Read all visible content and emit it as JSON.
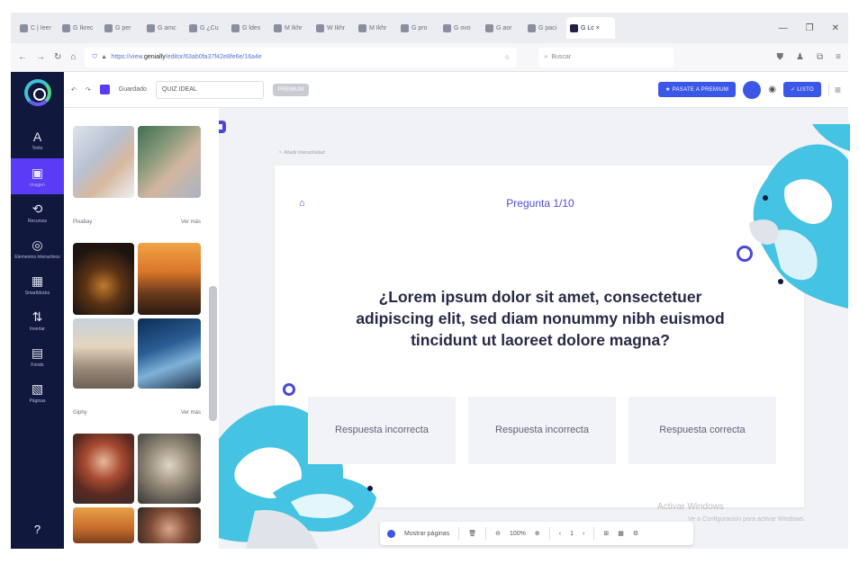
{
  "browser": {
    "tabs": [
      {
        "label": "C | Ieer"
      },
      {
        "label": "G Ikrec"
      },
      {
        "label": "G per"
      },
      {
        "label": "G amc"
      },
      {
        "label": "G ¿Cu"
      },
      {
        "label": "G ldes"
      },
      {
        "label": "M Ikhr"
      },
      {
        "label": "W Ikhr"
      },
      {
        "label": "M Ikhr"
      },
      {
        "label": "G pro"
      },
      {
        "label": "G ovo"
      },
      {
        "label": "G aor"
      },
      {
        "label": "G paci"
      },
      {
        "label": "G Lc ×",
        "active": true
      }
    ],
    "url_prefix": "https://view.",
    "url_host": "genially",
    "url_rest": "/editor/63ab0fa37f42e8fe6e/16a4e",
    "search_placeholder": "Buscar"
  },
  "toolbar": {
    "saved_label": "Guardado",
    "title_value": "QUIZ IDEAL",
    "badge": "PREMIUM",
    "upgrade_label": "PASATE A PREMIUM",
    "publish_label": "LISTO"
  },
  "rail": {
    "items": [
      {
        "icon": "A",
        "label": "Texto"
      },
      {
        "icon": "▣",
        "label": "Imagen",
        "active": true
      },
      {
        "icon": "⟲",
        "label": "Recursos"
      },
      {
        "icon": "◎",
        "label": "Elementos interactivos"
      },
      {
        "icon": "▦",
        "label": "Smartblocks"
      },
      {
        "icon": "⇅",
        "label": "Insertar"
      },
      {
        "icon": "▤",
        "label": "Fondo"
      },
      {
        "icon": "▧",
        "label": "Páginas"
      }
    ],
    "help": "?"
  },
  "panel": {
    "section1": {
      "title": "Pixabay",
      "more": "Ver más"
    },
    "section2": {
      "title": "Giphy",
      "more": "Ver más"
    }
  },
  "slide": {
    "page_tag": "Añadir interactividad",
    "counter": "Pregunta 1/10",
    "question": "¿Lorem ipsum dolor sit amet, consectetuer adipiscing elit, sed diam nonummy nibh euismod tincidunt ut laoreet dolore magna?",
    "answers": [
      {
        "label": "Respuesta incorrecta"
      },
      {
        "label": "Respuesta incorrecta"
      },
      {
        "label": "Respuesta correcta"
      }
    ]
  },
  "bottombar": {
    "pages_label": "Mostrar páginas",
    "zoom": "100%",
    "page_number": "1"
  },
  "watermark": {
    "line1": "Activar Windows",
    "line2": "Ve a Configuración para activar Windows."
  },
  "colors": {
    "accent": "#5b3bf5",
    "rail": "#11183d",
    "primary_button": "#3a57e8",
    "deco": "#45c3e3"
  }
}
